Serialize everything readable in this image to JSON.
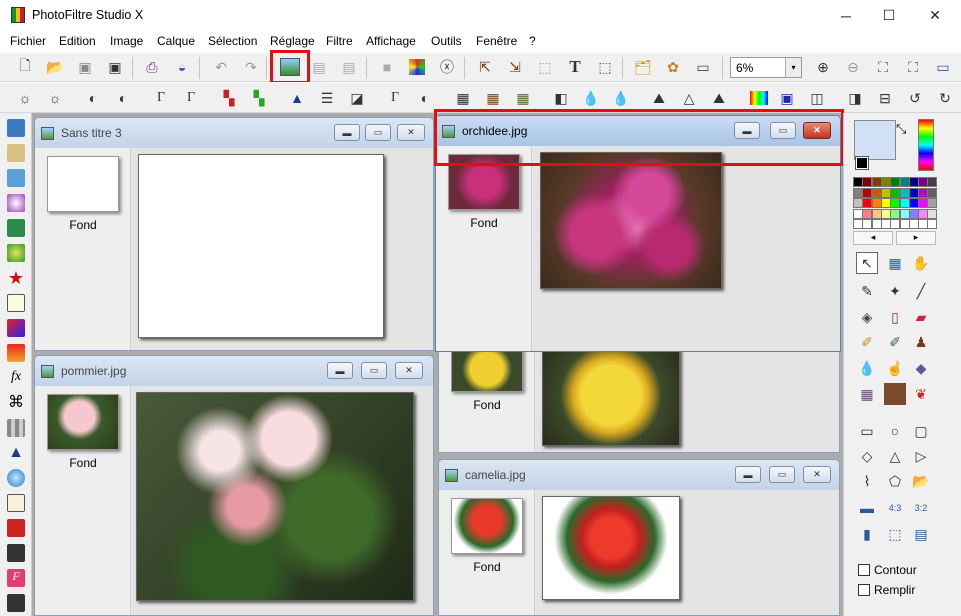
{
  "window": {
    "title": "PhotoFiltre Studio X",
    "minimize": "─",
    "maximize": "☐",
    "close": "✕"
  },
  "menu": [
    "Fichier",
    "Edition",
    "Image",
    "Calque",
    "Sélection",
    "Réglage",
    "Filtre",
    "Affichage",
    "Outils",
    "Fenêtre",
    "?"
  ],
  "zoom": {
    "value": "6%",
    "arrow": "▾"
  },
  "documents": [
    {
      "name": "Sans titre 3",
      "layer": "Fond"
    },
    {
      "name": "orchidee.jpg",
      "layer": "Fond"
    },
    {
      "name": "pommier.jpg",
      "layer": "Fond"
    },
    {
      "name": "",
      "layer": "Fond"
    },
    {
      "name": "camelia.jpg",
      "layer": "Fond"
    }
  ],
  "palette_nav": {
    "left": "◂",
    "right": "▸"
  },
  "options": {
    "contour": "Contour",
    "remplir": "Remplir"
  },
  "colors": {
    "highlight": "#e01010",
    "foreground": "#cfe0f7",
    "background": "#000000"
  }
}
